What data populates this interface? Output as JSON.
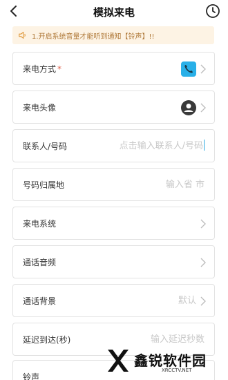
{
  "header": {
    "title": "模拟来电",
    "back_icon": "chevron-left-icon",
    "history_icon": "clock-icon"
  },
  "notice": {
    "text": "1.开启系统音量才能听到通知【铃声】!!",
    "icon": "speaker-icon",
    "color": "#b07a3a",
    "background": "#fdf3e4"
  },
  "form": {
    "rows": [
      {
        "label": "来电方式",
        "required_mark": "*",
        "icon": "phone-icon",
        "icon_color": "#29b0e8"
      },
      {
        "label": "来电头像",
        "icon": "avatar-icon"
      },
      {
        "label": "联系人/号码",
        "placeholder": "点击输入联系人/号码"
      },
      {
        "label": "号码归属地",
        "placeholder": "输入省 市"
      },
      {
        "label": "来电系统"
      },
      {
        "label": "通话音频"
      },
      {
        "label": "通话背景",
        "value": "默认"
      },
      {
        "label": "延迟到达(秒)",
        "placeholder": "输入延迟秒数"
      },
      {
        "label": "铃声"
      }
    ]
  },
  "watermark": {
    "brand": "鑫锐软件园",
    "site": "XRCCTV.NET"
  }
}
